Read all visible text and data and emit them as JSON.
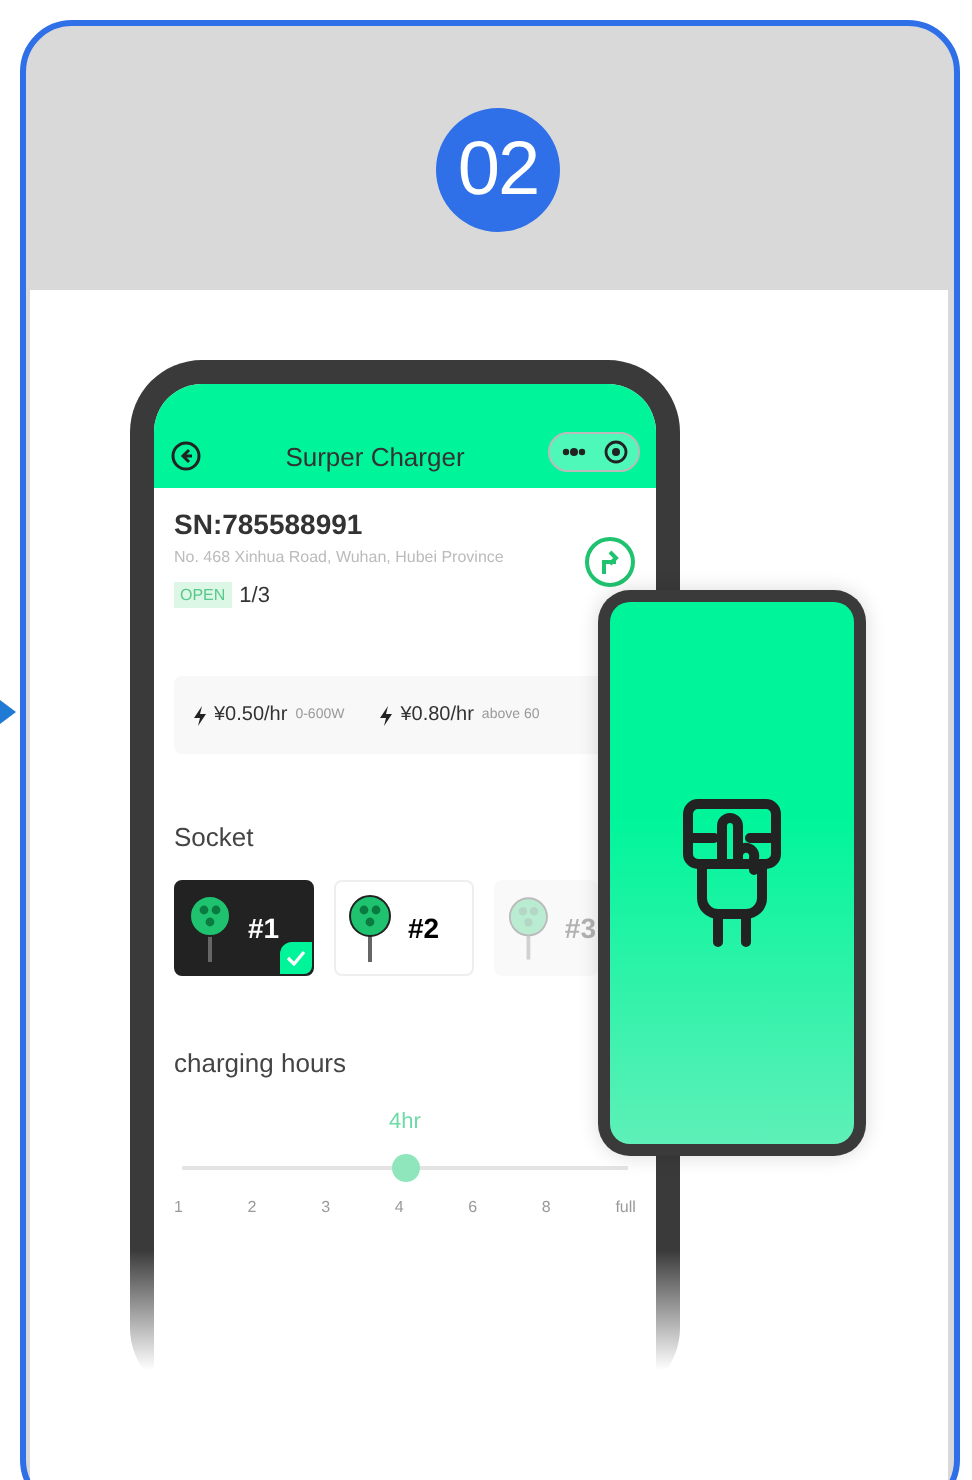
{
  "step": {
    "number": "02"
  },
  "app": {
    "title": "Surper Charger",
    "serial": "SN:785588991",
    "address": "No. 468 Xinhua Road, Wuhan, Hubei Province",
    "status": "OPEN",
    "availability": "1/3",
    "prices": [
      {
        "price": "¥0.50/hr",
        "range": "0-600W"
      },
      {
        "price": "¥0.80/hr",
        "range": "above 60"
      }
    ],
    "socket_heading": "Socket",
    "sockets": [
      {
        "label": "#1",
        "selected": true,
        "disabled": false
      },
      {
        "label": "#2",
        "selected": false,
        "disabled": false
      },
      {
        "label": "#3",
        "selected": false,
        "disabled": true
      }
    ],
    "hours_heading": "charging hours",
    "hours_value": "4hr",
    "hours_slider": {
      "level": 0.5
    },
    "hours_ticks": [
      "1",
      "2",
      "3",
      "4",
      "6",
      "8",
      "full"
    ]
  }
}
